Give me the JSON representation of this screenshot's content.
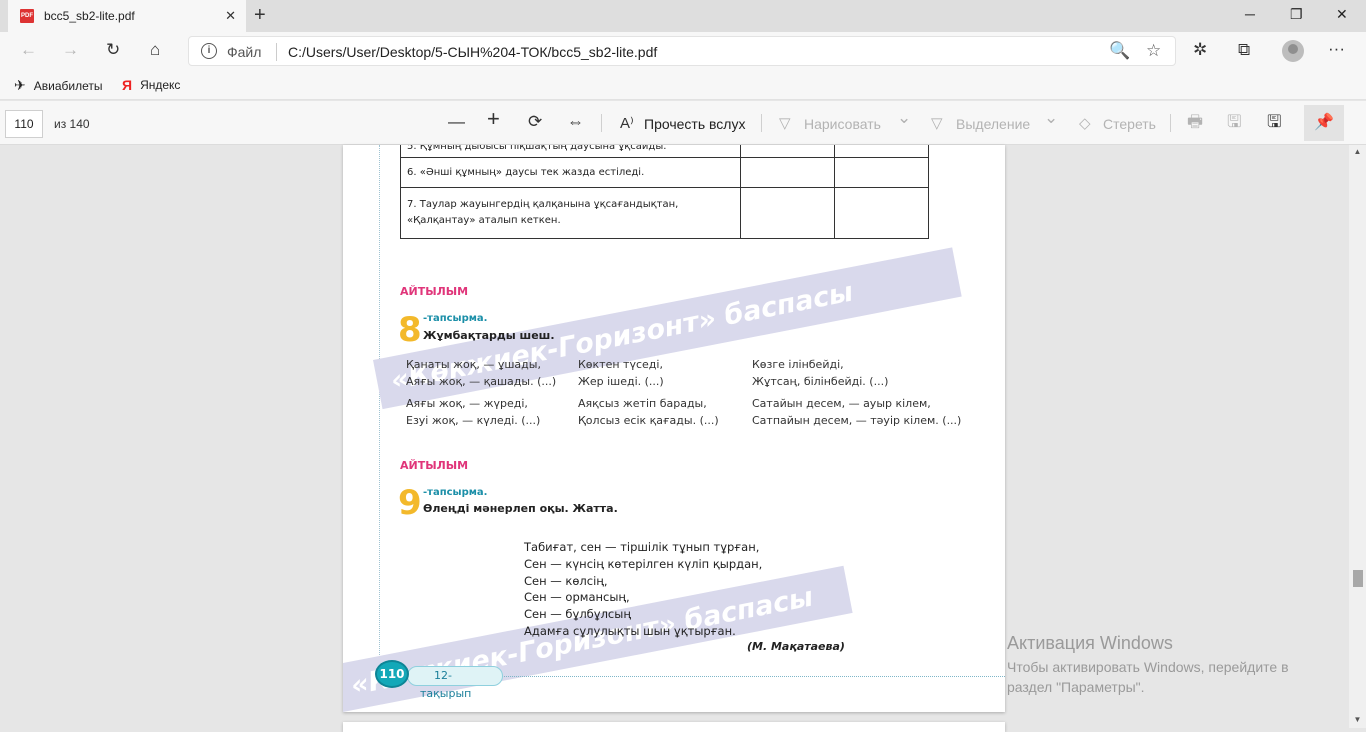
{
  "tab": {
    "title": "bcc5_sb2-lite.pdf",
    "close": "✕",
    "new": "+"
  },
  "window": {
    "minimize": "─",
    "restore": "❐",
    "close": "✕"
  },
  "nav": {
    "back": "←",
    "forward": "→",
    "refresh": "↻",
    "home": "⌂",
    "info": "i",
    "scheme": "Файл",
    "url": "C:/Users/User/Desktop/5-СЫН%204-ТОК/bcc5_sb2-lite.pdf",
    "zoom": "🔍",
    "star": "☆",
    "favorites": "✲",
    "collections": "⧉",
    "more": "···"
  },
  "favorites": [
    {
      "label": "Авиабилеты",
      "icon": "✈"
    },
    {
      "label": "Яндекс",
      "icon": "Я"
    }
  ],
  "pdf_toolbar": {
    "page": "110",
    "of": "из 140",
    "zoom_out": "—",
    "zoom_in": "+",
    "rotate": "⟳",
    "fit": "⇔",
    "read_aloud_icon": "A⁾",
    "read_aloud": "Прочесть вслух",
    "draw_icon": "▽",
    "draw": "Нарисовать",
    "highlight_icon": "▽",
    "highlight": "Выделение",
    "erase_icon": "◇",
    "erase": "Стереть",
    "chevron": "⌄",
    "print": "🖶",
    "save": "🖫",
    "save_as": "🖫",
    "pin": "📌"
  },
  "scrollbar": {
    "up": "▲",
    "down": "▼"
  },
  "document": {
    "table_rows": [
      {
        "text": "5. Құмның дыбысы піқшақтың даусына ұқсайды.",
        "c1": "",
        "c2": ""
      },
      {
        "text": "6. «Әнші құмның» даусы тек жазда естіледі.",
        "c1": "",
        "c2": ""
      },
      {
        "text": "7. Таулар жауынгердің қалқанына ұқсағандықтан, «Қалқантау» аталып кеткен.",
        "c1": "",
        "c2": ""
      }
    ],
    "watermark": "«Көкжиек-Горизонт» баспасы",
    "section1": "АЙТЫЛЫМ",
    "task8": {
      "num": "8",
      "label": "-тапсырма.",
      "title": "Жұмбақтарды шеш."
    },
    "riddles": [
      {
        "l1": "Қанаты жоқ, — ұшады,",
        "l2": "Аяғы жоқ, — қашады. (...)"
      },
      {
        "l1": "Көктен түседі,",
        "l2": "Жер ішеді. (...)"
      },
      {
        "l1": "Көзге ілінбейді,",
        "l2": "Жұтсаң, білінбейді. (...)"
      },
      {
        "l1": "Аяғы жоқ, — жүреді,",
        "l2": "Езуі жоқ, — күледі. (...)"
      },
      {
        "l1": "Аяқсыз жетіп барады,",
        "l2": "Қолсыз есік қағады. (...)"
      },
      {
        "l1": "Сатайын десем, — ауыр кілем,",
        "l2": "Сатпайын десем, — тәуір кілем. (...)"
      }
    ],
    "section2": "АЙТЫЛЫМ",
    "task9": {
      "num": "9",
      "label": "-тапсырма.",
      "title": "Өлеңді мәнерлеп оқы. Жатта."
    },
    "poem": [
      "Табиғат, сен — тіршілік тұнып тұрған,",
      "Сен — күнсің көтерілген күліп қырдан,",
      "Сен — көлсің,",
      "Сен — ормансың,",
      "Сен — бұлбұлсың",
      "Адамға сұлулықты шын ұқтырған."
    ],
    "author": "(М. Мақатаева)",
    "footer": {
      "page": "110",
      "topic": "12-тақырып"
    }
  },
  "activation": {
    "title": "Активация Windows",
    "text": "Чтобы активировать Windows, перейдите в раздел \"Параметры\"."
  }
}
